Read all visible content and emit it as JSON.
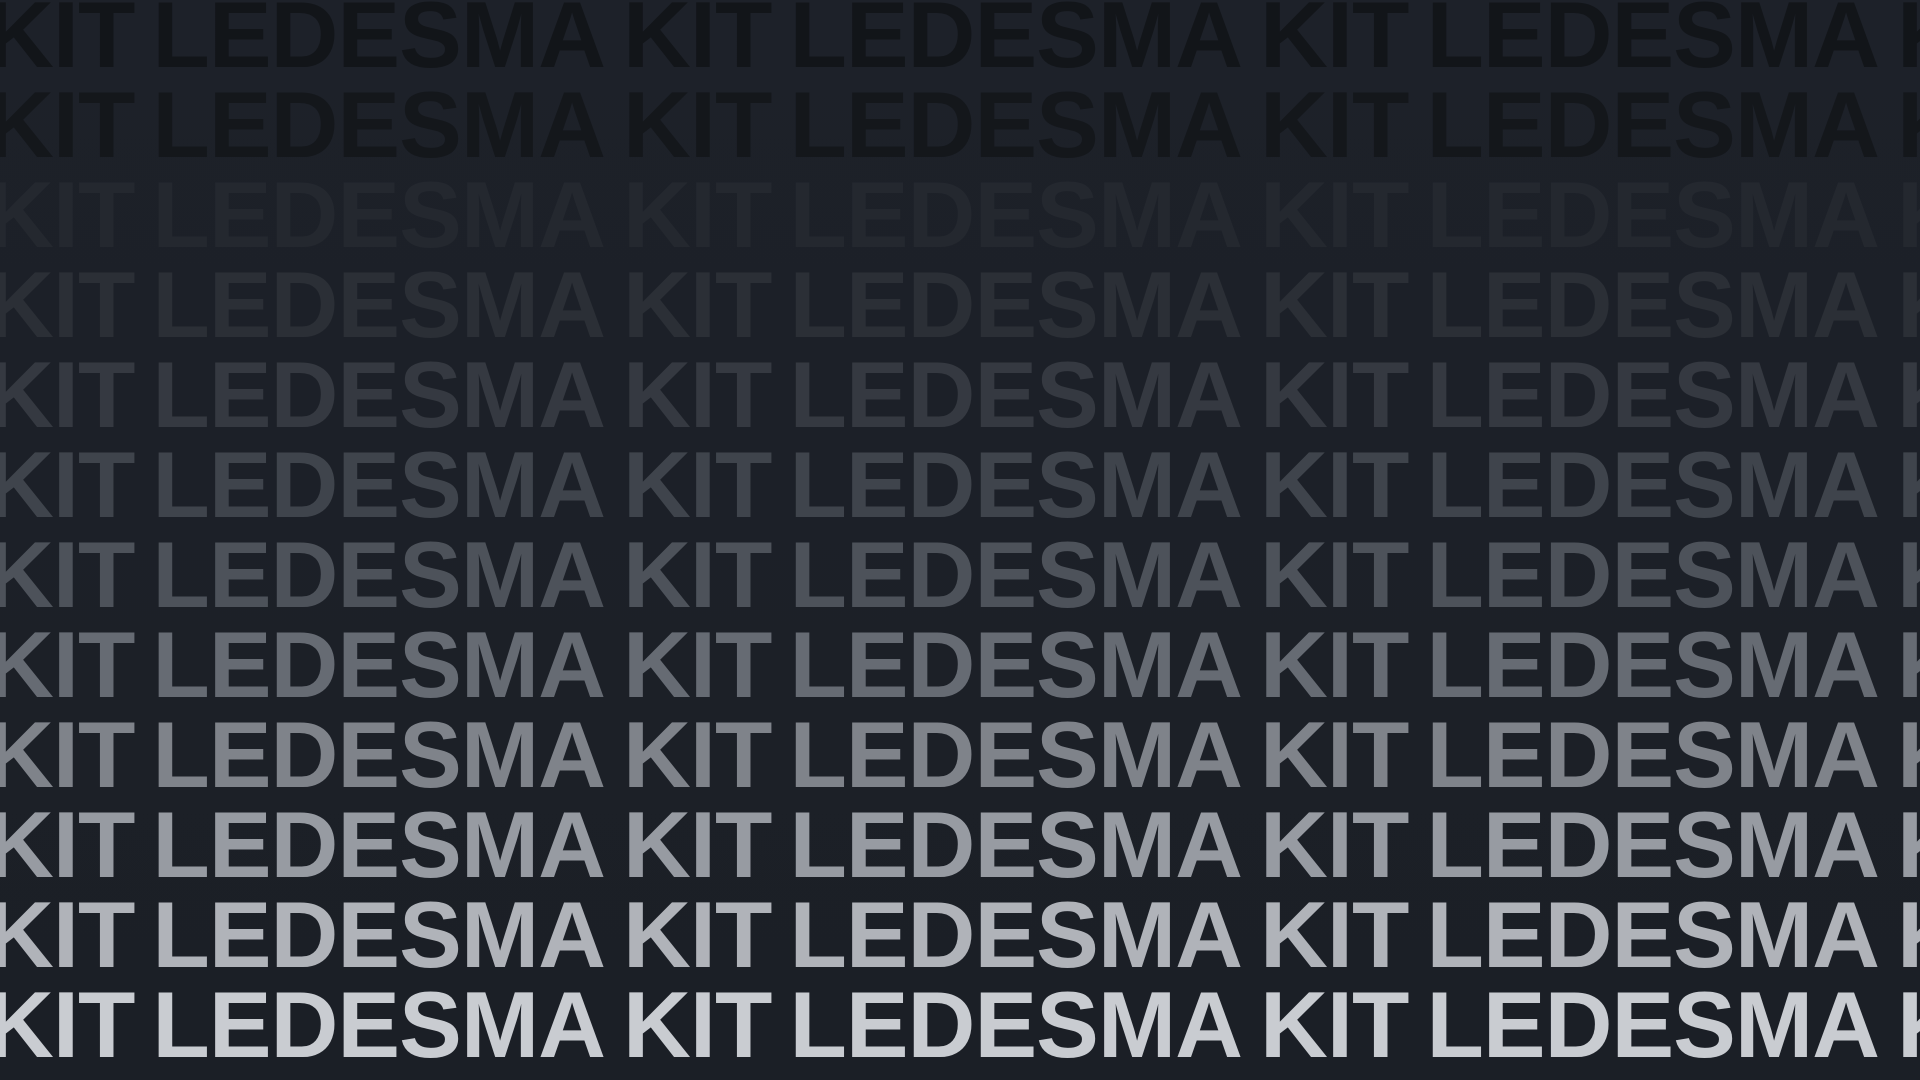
{
  "pattern": {
    "words": [
      "KIT",
      "LEDESMA"
    ],
    "colors": {
      "background": "#1b1f26",
      "row_shades": [
        "#121519",
        "#14171b",
        "#24282f",
        "#2b2f36",
        "#353941",
        "#3f444c",
        "#4d525a",
        "#666b73",
        "#7f838a",
        "#979ba2",
        "#b0b3b9",
        "#c9ccd1"
      ]
    }
  }
}
